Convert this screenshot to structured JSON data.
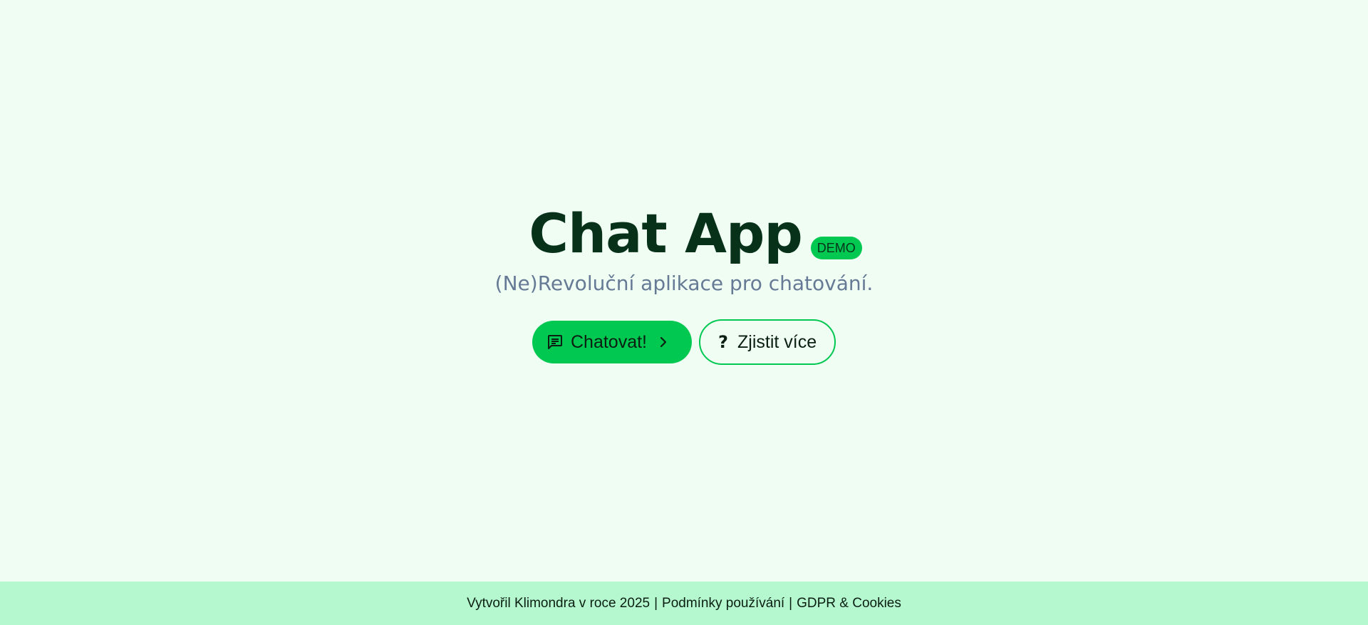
{
  "hero": {
    "title": "Chat App",
    "badge": "DEMO",
    "subtitle": "(Ne)Revoluční aplikace pro chatování."
  },
  "actions": {
    "chat_label": "Chatovat!",
    "chat_icon": "chat-message-icon",
    "chat_chevron_icon": "chevron-right-icon",
    "learn_more_label": "Zjistit více",
    "learn_more_icon": "?"
  },
  "footer": {
    "credit": "Vytvořil Klimondra v roce 2025",
    "separator": "|",
    "terms_link": "Podmínky používání",
    "gdpr_link": "GDPR & Cookies"
  },
  "colors": {
    "background": "#effdf3",
    "accent": "#00c851",
    "footer_background": "#b5f7cf",
    "title": "#073219",
    "subtitle": "#667a95"
  }
}
